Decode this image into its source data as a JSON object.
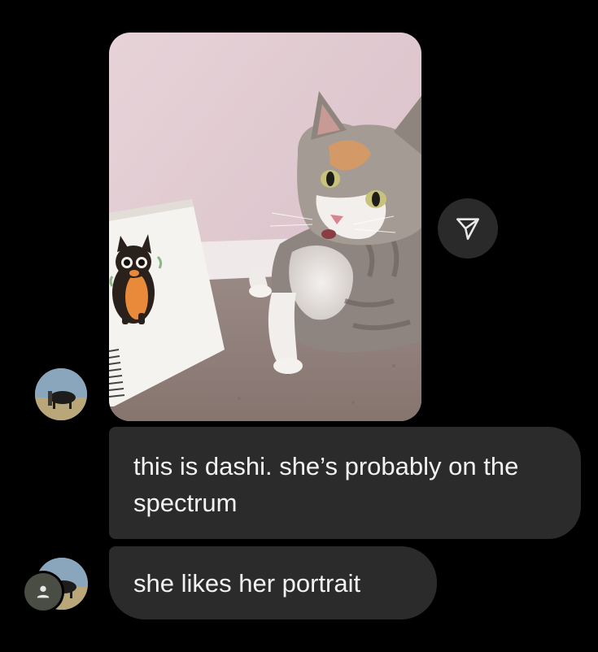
{
  "messages": [
    {
      "type": "photo",
      "sender": "other",
      "image_description": "photo-message"
    },
    {
      "type": "text",
      "text": "this is dashi. she’s probably on the spectrum"
    },
    {
      "type": "text",
      "text": "she likes her portrait"
    }
  ],
  "icons": {
    "share": "paper-plane-icon",
    "avatar_badge": "person-icon"
  },
  "colors": {
    "background": "#000000",
    "bubble": "#2b2b2b",
    "bubble_text": "#f2f2f2",
    "share_button": "#2a2a2a"
  }
}
